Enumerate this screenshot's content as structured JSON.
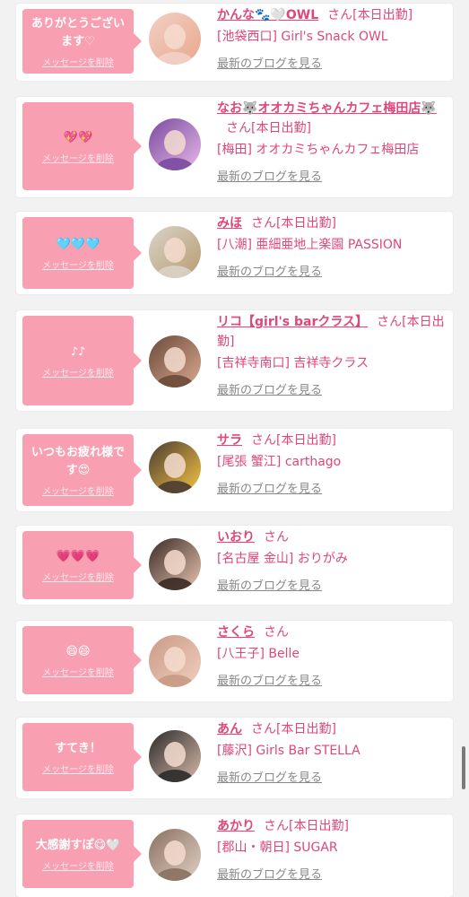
{
  "delete_label": "メッセージを削除",
  "blog_label": "最新のブログを見る",
  "accent_color": "#e0467c",
  "bubble_color": "#f8a0b2",
  "cards": [
    {
      "message": "ありがとうございます♡",
      "name": "かんな🐾🤍OWL",
      "suffix": "さん[本日出勤]",
      "shop": "[池袋西口] Girl's Snack OWL",
      "avatar_colors": [
        "#f2d0c6",
        "#e9a78c"
      ]
    },
    {
      "message": "💖💖",
      "name": "なお🐺オオカミちゃんカフェ梅田店🐺",
      "suffix": "さん[本日出勤]",
      "shop": "[梅田] オオカミちゃんカフェ梅田店",
      "avatar_colors": [
        "#7a4aa0",
        "#e6b8e6"
      ]
    },
    {
      "message": "🩵🩵🩵",
      "name": "みほ",
      "suffix": "さん[本日出勤]",
      "shop": "[八潮] 亜細亜地上楽園 PASSION",
      "avatar_colors": [
        "#d9d3c8",
        "#b79c72"
      ]
    },
    {
      "message": "♪♪",
      "name": "リコ【girl's barクラス】",
      "suffix": "さん[本日出勤]",
      "shop": "[吉祥寺南口] 吉祥寺クラス",
      "avatar_colors": [
        "#6b4a3a",
        "#d9a88e"
      ]
    },
    {
      "message": "いつもお疲れ様です😍",
      "name": "サラ",
      "suffix": "さん[本日出勤]",
      "shop": "[尾張 蟹江] carthago",
      "avatar_colors": [
        "#4a3b32",
        "#f5c542"
      ]
    },
    {
      "message": "💗💗💗",
      "name": "いおり",
      "suffix": "さん",
      "shop": "[名古屋 金山] おりがみ",
      "avatar_colors": [
        "#3a2a25",
        "#e8c4b0"
      ]
    },
    {
      "message": "😄😄",
      "name": "さくら",
      "suffix": "さん",
      "shop": "[八王子] Belle",
      "avatar_colors": [
        "#c99a84",
        "#f0cfc0"
      ]
    },
    {
      "message": "すてき！",
      "name": "あん",
      "suffix": "さん[本日出勤]",
      "shop": "[藤沢] Girls Bar STELLA",
      "avatar_colors": [
        "#2b2b2b",
        "#d8b8a8"
      ]
    },
    {
      "message": "大感謝すぽ😋🤍",
      "name": "あかり",
      "suffix": "さん[本日出勤]",
      "shop": "[郡山・朝日] SUGAR",
      "avatar_colors": [
        "#8a7060",
        "#e0d0c4"
      ]
    }
  ]
}
